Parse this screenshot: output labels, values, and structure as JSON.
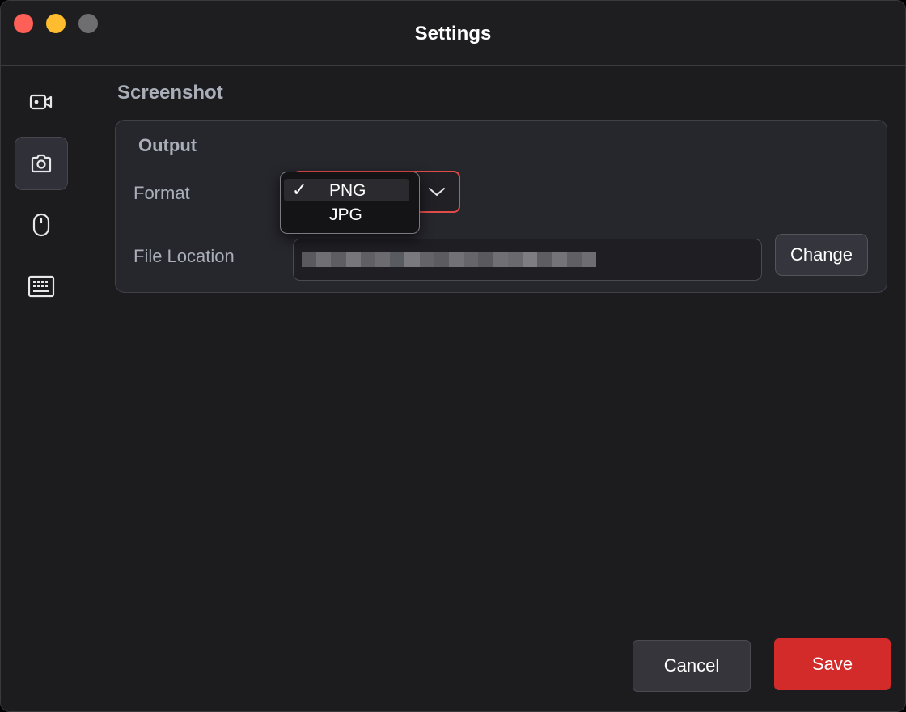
{
  "window": {
    "title": "Settings",
    "controls": [
      "close",
      "minimize",
      "maximize"
    ]
  },
  "sidebar": {
    "items": [
      {
        "icon": "video-camera-icon",
        "active": false
      },
      {
        "icon": "camera-icon",
        "active": true
      },
      {
        "icon": "mouse-icon",
        "active": false
      },
      {
        "icon": "keyboard-icon",
        "active": false
      }
    ]
  },
  "main": {
    "section_title": "Screenshot",
    "card": {
      "title": "Output",
      "format": {
        "label": "Format",
        "selected": "PNG",
        "options": [
          "PNG",
          "JPG"
        ]
      },
      "file_location": {
        "label": "File Location",
        "value": "",
        "change_label": "Change"
      }
    }
  },
  "dropdown": {
    "check": "✓",
    "items": [
      "PNG",
      "JPG"
    ]
  },
  "footer": {
    "cancel_label": "Cancel",
    "save_label": "Save"
  },
  "colors": {
    "accent": "#d32a2a",
    "focus_border": "#e24c48",
    "background": "#1c1c1f"
  }
}
